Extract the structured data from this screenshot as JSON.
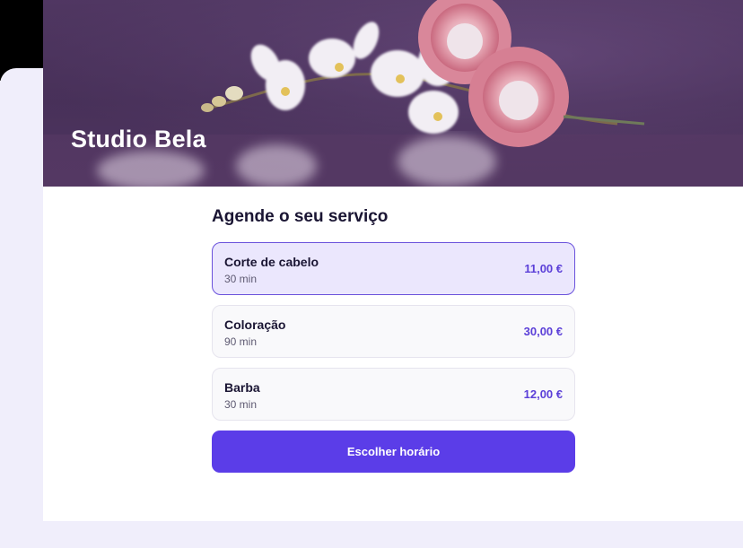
{
  "colors": {
    "accent": "#5b3de8",
    "selected_bg": "#ebe7fd",
    "selected_border": "#6a52dc",
    "price": "#5b3fd8",
    "hero_bg": "#4e3560",
    "page_bg": "#f0eefb"
  },
  "header": {
    "brand_name": "Studio Bela"
  },
  "booking": {
    "title": "Agende o seu serviço",
    "services": [
      {
        "name": "Corte de cabelo",
        "duration": "30 min",
        "price": "11,00 €",
        "selected": true
      },
      {
        "name": "Coloração",
        "duration": "90 min",
        "price": "30,00 €",
        "selected": false
      },
      {
        "name": "Barba",
        "duration": "30 min",
        "price": "12,00 €",
        "selected": false
      }
    ],
    "cta_label": "Escolher horário"
  }
}
